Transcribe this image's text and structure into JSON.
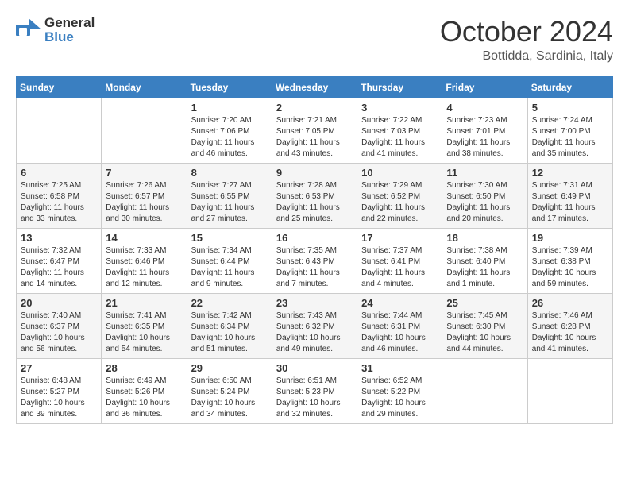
{
  "logo": {
    "general": "General",
    "blue": "Blue"
  },
  "title": "October 2024",
  "location": "Bottidda, Sardinia, Italy",
  "days_of_week": [
    "Sunday",
    "Monday",
    "Tuesday",
    "Wednesday",
    "Thursday",
    "Friday",
    "Saturday"
  ],
  "weeks": [
    [
      {
        "day": "",
        "info": ""
      },
      {
        "day": "",
        "info": ""
      },
      {
        "day": "1",
        "info": "Sunrise: 7:20 AM\nSunset: 7:06 PM\nDaylight: 11 hours and 46 minutes."
      },
      {
        "day": "2",
        "info": "Sunrise: 7:21 AM\nSunset: 7:05 PM\nDaylight: 11 hours and 43 minutes."
      },
      {
        "day": "3",
        "info": "Sunrise: 7:22 AM\nSunset: 7:03 PM\nDaylight: 11 hours and 41 minutes."
      },
      {
        "day": "4",
        "info": "Sunrise: 7:23 AM\nSunset: 7:01 PM\nDaylight: 11 hours and 38 minutes."
      },
      {
        "day": "5",
        "info": "Sunrise: 7:24 AM\nSunset: 7:00 PM\nDaylight: 11 hours and 35 minutes."
      }
    ],
    [
      {
        "day": "6",
        "info": "Sunrise: 7:25 AM\nSunset: 6:58 PM\nDaylight: 11 hours and 33 minutes."
      },
      {
        "day": "7",
        "info": "Sunrise: 7:26 AM\nSunset: 6:57 PM\nDaylight: 11 hours and 30 minutes."
      },
      {
        "day": "8",
        "info": "Sunrise: 7:27 AM\nSunset: 6:55 PM\nDaylight: 11 hours and 27 minutes."
      },
      {
        "day": "9",
        "info": "Sunrise: 7:28 AM\nSunset: 6:53 PM\nDaylight: 11 hours and 25 minutes."
      },
      {
        "day": "10",
        "info": "Sunrise: 7:29 AM\nSunset: 6:52 PM\nDaylight: 11 hours and 22 minutes."
      },
      {
        "day": "11",
        "info": "Sunrise: 7:30 AM\nSunset: 6:50 PM\nDaylight: 11 hours and 20 minutes."
      },
      {
        "day": "12",
        "info": "Sunrise: 7:31 AM\nSunset: 6:49 PM\nDaylight: 11 hours and 17 minutes."
      }
    ],
    [
      {
        "day": "13",
        "info": "Sunrise: 7:32 AM\nSunset: 6:47 PM\nDaylight: 11 hours and 14 minutes."
      },
      {
        "day": "14",
        "info": "Sunrise: 7:33 AM\nSunset: 6:46 PM\nDaylight: 11 hours and 12 minutes."
      },
      {
        "day": "15",
        "info": "Sunrise: 7:34 AM\nSunset: 6:44 PM\nDaylight: 11 hours and 9 minutes."
      },
      {
        "day": "16",
        "info": "Sunrise: 7:35 AM\nSunset: 6:43 PM\nDaylight: 11 hours and 7 minutes."
      },
      {
        "day": "17",
        "info": "Sunrise: 7:37 AM\nSunset: 6:41 PM\nDaylight: 11 hours and 4 minutes."
      },
      {
        "day": "18",
        "info": "Sunrise: 7:38 AM\nSunset: 6:40 PM\nDaylight: 11 hours and 1 minute."
      },
      {
        "day": "19",
        "info": "Sunrise: 7:39 AM\nSunset: 6:38 PM\nDaylight: 10 hours and 59 minutes."
      }
    ],
    [
      {
        "day": "20",
        "info": "Sunrise: 7:40 AM\nSunset: 6:37 PM\nDaylight: 10 hours and 56 minutes."
      },
      {
        "day": "21",
        "info": "Sunrise: 7:41 AM\nSunset: 6:35 PM\nDaylight: 10 hours and 54 minutes."
      },
      {
        "day": "22",
        "info": "Sunrise: 7:42 AM\nSunset: 6:34 PM\nDaylight: 10 hours and 51 minutes."
      },
      {
        "day": "23",
        "info": "Sunrise: 7:43 AM\nSunset: 6:32 PM\nDaylight: 10 hours and 49 minutes."
      },
      {
        "day": "24",
        "info": "Sunrise: 7:44 AM\nSunset: 6:31 PM\nDaylight: 10 hours and 46 minutes."
      },
      {
        "day": "25",
        "info": "Sunrise: 7:45 AM\nSunset: 6:30 PM\nDaylight: 10 hours and 44 minutes."
      },
      {
        "day": "26",
        "info": "Sunrise: 7:46 AM\nSunset: 6:28 PM\nDaylight: 10 hours and 41 minutes."
      }
    ],
    [
      {
        "day": "27",
        "info": "Sunrise: 6:48 AM\nSunset: 5:27 PM\nDaylight: 10 hours and 39 minutes."
      },
      {
        "day": "28",
        "info": "Sunrise: 6:49 AM\nSunset: 5:26 PM\nDaylight: 10 hours and 36 minutes."
      },
      {
        "day": "29",
        "info": "Sunrise: 6:50 AM\nSunset: 5:24 PM\nDaylight: 10 hours and 34 minutes."
      },
      {
        "day": "30",
        "info": "Sunrise: 6:51 AM\nSunset: 5:23 PM\nDaylight: 10 hours and 32 minutes."
      },
      {
        "day": "31",
        "info": "Sunrise: 6:52 AM\nSunset: 5:22 PM\nDaylight: 10 hours and 29 minutes."
      },
      {
        "day": "",
        "info": ""
      },
      {
        "day": "",
        "info": ""
      }
    ]
  ]
}
